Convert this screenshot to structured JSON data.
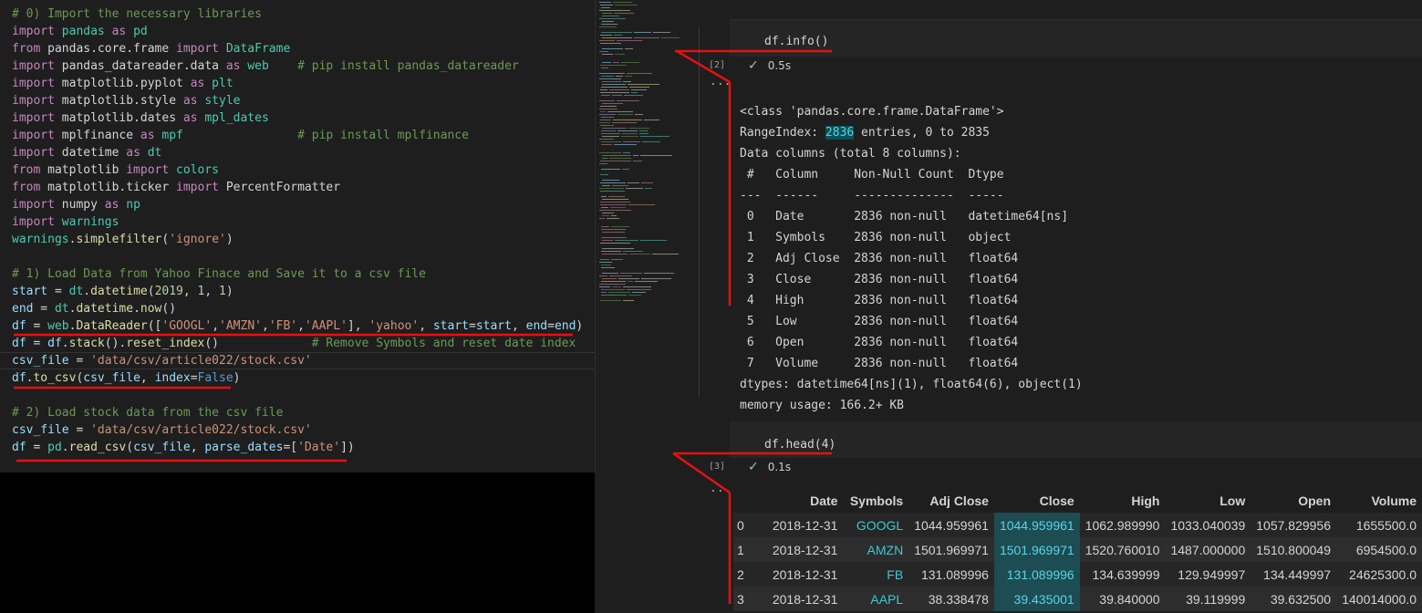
{
  "editor": {
    "lines": [
      [
        [
          "cm",
          "# 0) Import the necessary libraries"
        ]
      ],
      [
        [
          "kw",
          "import"
        ],
        [
          "plain",
          " "
        ],
        [
          "cls",
          "pandas"
        ],
        [
          "plain",
          " "
        ],
        [
          "kw",
          "as"
        ],
        [
          "plain",
          " "
        ],
        [
          "cls",
          "pd"
        ]
      ],
      [
        [
          "kw",
          "from"
        ],
        [
          "plain",
          " pandas.core.frame "
        ],
        [
          "kw",
          "import"
        ],
        [
          "plain",
          " "
        ],
        [
          "cls",
          "DataFrame"
        ]
      ],
      [
        [
          "kw",
          "import"
        ],
        [
          "plain",
          " pandas_datareader.data "
        ],
        [
          "kw",
          "as"
        ],
        [
          "plain",
          " "
        ],
        [
          "cls",
          "web"
        ],
        [
          "plain",
          "    "
        ],
        [
          "cm",
          "# pip install pandas_datareader"
        ]
      ],
      [
        [
          "kw",
          "import"
        ],
        [
          "plain",
          " matplotlib.pyplot "
        ],
        [
          "kw",
          "as"
        ],
        [
          "plain",
          " "
        ],
        [
          "cls",
          "plt"
        ]
      ],
      [
        [
          "kw",
          "import"
        ],
        [
          "plain",
          " matplotlib.style "
        ],
        [
          "kw",
          "as"
        ],
        [
          "plain",
          " "
        ],
        [
          "cls",
          "style"
        ]
      ],
      [
        [
          "kw",
          "import"
        ],
        [
          "plain",
          " matplotlib.dates "
        ],
        [
          "kw",
          "as"
        ],
        [
          "plain",
          " "
        ],
        [
          "cls",
          "mpl_dates"
        ]
      ],
      [
        [
          "kw",
          "import"
        ],
        [
          "plain",
          " mplfinance "
        ],
        [
          "kw",
          "as"
        ],
        [
          "plain",
          " "
        ],
        [
          "cls",
          "mpf"
        ],
        [
          "plain",
          "                "
        ],
        [
          "cm",
          "# pip install mplfinance"
        ]
      ],
      [
        [
          "kw",
          "import"
        ],
        [
          "plain",
          " datetime "
        ],
        [
          "kw",
          "as"
        ],
        [
          "plain",
          " "
        ],
        [
          "cls",
          "dt"
        ]
      ],
      [
        [
          "kw",
          "from"
        ],
        [
          "plain",
          " matplotlib "
        ],
        [
          "kw",
          "import"
        ],
        [
          "plain",
          " "
        ],
        [
          "cls",
          "colors"
        ]
      ],
      [
        [
          "kw",
          "from"
        ],
        [
          "plain",
          " matplotlib.ticker "
        ],
        [
          "kw",
          "import"
        ],
        [
          "plain",
          " PercentFormatter"
        ]
      ],
      [
        [
          "kw",
          "import"
        ],
        [
          "plain",
          " numpy "
        ],
        [
          "kw",
          "as"
        ],
        [
          "plain",
          " "
        ],
        [
          "cls",
          "np"
        ]
      ],
      [
        [
          "kw",
          "import"
        ],
        [
          "plain",
          " "
        ],
        [
          "cls",
          "warnings"
        ]
      ],
      [
        [
          "cls",
          "warnings"
        ],
        [
          "plain",
          "."
        ],
        [
          "fn",
          "simplefilter"
        ],
        [
          "plain",
          "("
        ],
        [
          "str",
          "'ignore'"
        ],
        [
          "plain",
          ")"
        ]
      ],
      [
        [
          "plain",
          ""
        ]
      ],
      [
        [
          "cm",
          "# 1) Load Data from Yahoo Finace and Save it to a csv file"
        ]
      ],
      [
        [
          "var",
          "start"
        ],
        [
          "plain",
          " = "
        ],
        [
          "cls",
          "dt"
        ],
        [
          "plain",
          "."
        ],
        [
          "fn",
          "datetime"
        ],
        [
          "plain",
          "("
        ],
        [
          "num",
          "2019"
        ],
        [
          "plain",
          ", "
        ],
        [
          "num",
          "1"
        ],
        [
          "plain",
          ", "
        ],
        [
          "num",
          "1"
        ],
        [
          "plain",
          ")"
        ]
      ],
      [
        [
          "var",
          "end"
        ],
        [
          "plain",
          " = "
        ],
        [
          "cls",
          "dt"
        ],
        [
          "plain",
          "."
        ],
        [
          "fn",
          "datetime"
        ],
        [
          "plain",
          "."
        ],
        [
          "fn",
          "now"
        ],
        [
          "plain",
          "()"
        ]
      ],
      [
        [
          "var",
          "df"
        ],
        [
          "plain",
          " = "
        ],
        [
          "cls",
          "web"
        ],
        [
          "plain",
          "."
        ],
        [
          "fn",
          "DataReader"
        ],
        [
          "plain",
          "(["
        ],
        [
          "str",
          "'GOOGL'"
        ],
        [
          "plain",
          ","
        ],
        [
          "str",
          "'AMZN'"
        ],
        [
          "plain",
          ","
        ],
        [
          "str",
          "'FB'"
        ],
        [
          "plain",
          ","
        ],
        [
          "str",
          "'AAPL'"
        ],
        [
          "plain",
          "], "
        ],
        [
          "str",
          "'yahoo'"
        ],
        [
          "plain",
          ", "
        ],
        [
          "var",
          "start"
        ],
        [
          "plain",
          "="
        ],
        [
          "var",
          "start"
        ],
        [
          "plain",
          ", "
        ],
        [
          "var",
          "end"
        ],
        [
          "plain",
          "="
        ],
        [
          "var",
          "end"
        ],
        [
          "plain",
          ")"
        ]
      ],
      [
        [
          "var",
          "df"
        ],
        [
          "plain",
          " = "
        ],
        [
          "var",
          "df"
        ],
        [
          "plain",
          "."
        ],
        [
          "fn",
          "stack"
        ],
        [
          "plain",
          "()."
        ],
        [
          "fn",
          "reset_index"
        ],
        [
          "plain",
          "()"
        ],
        [
          "plain",
          "             "
        ],
        [
          "cm",
          "# Remove Symbols and reset date index"
        ]
      ],
      [
        [
          "var",
          "csv_file"
        ],
        [
          "plain",
          " = "
        ],
        [
          "str",
          "'data/csv/article022/stock.csv'"
        ]
      ],
      [
        [
          "var",
          "df"
        ],
        [
          "plain",
          "."
        ],
        [
          "fn",
          "to_csv"
        ],
        [
          "plain",
          "("
        ],
        [
          "var",
          "csv_file"
        ],
        [
          "plain",
          ", "
        ],
        [
          "var",
          "index"
        ],
        [
          "plain",
          "="
        ],
        [
          "cst",
          "False"
        ],
        [
          "plain",
          ")"
        ]
      ],
      [
        [
          "plain",
          ""
        ]
      ],
      [
        [
          "cm",
          "# 2) Load stock data from the csv file"
        ]
      ],
      [
        [
          "var",
          "csv_file"
        ],
        [
          "plain",
          " = "
        ],
        [
          "str",
          "'data/csv/article022/stock.csv'"
        ]
      ],
      [
        [
          "var",
          "df"
        ],
        [
          "plain",
          " = "
        ],
        [
          "cls",
          "pd"
        ],
        [
          "plain",
          "."
        ],
        [
          "fn",
          "read_csv"
        ],
        [
          "plain",
          "("
        ],
        [
          "var",
          "csv_file"
        ],
        [
          "plain",
          ", "
        ],
        [
          "var",
          "parse_dates"
        ],
        [
          "plain",
          "=["
        ],
        [
          "str",
          "'Date'"
        ],
        [
          "plain",
          "])"
        ]
      ]
    ]
  },
  "cells": {
    "info": {
      "code": "df.info()",
      "counter": "[2]",
      "time": "0.5s"
    },
    "head": {
      "code": "df.head(4)",
      "counter": "[3]",
      "time": "0.1s"
    }
  },
  "info_output": {
    "class_line": "<class 'pandas.core.frame.DataFrame'>",
    "range_prefix": "RangeIndex: ",
    "range_count": "2836",
    "range_suffix": " entries, 0 to 2835",
    "data_columns": "Data columns (total 8 columns):",
    "header": " #   Column     Non-Null Count  Dtype",
    "dashes": "---  ------     --------------  -----",
    "rows": [
      " 0   Date       2836 non-null   datetime64[ns]",
      " 1   Symbols    2836 non-null   object",
      " 2   Adj Close  2836 non-null   float64",
      " 3   Close      2836 non-null   float64",
      " 4   High       2836 non-null   float64",
      " 5   Low        2836 non-null   float64",
      " 6   Open       2836 non-null   float64",
      " 7   Volume     2836 non-null   float64"
    ],
    "dtypes": "dtypes: datetime64[ns](1), float64(6), object(1)",
    "memory": "memory usage: 166.2+ KB"
  },
  "head_table": {
    "columns": [
      "",
      "Date",
      "Symbols",
      "Adj Close",
      "Close",
      "High",
      "Low",
      "Open",
      "Volume"
    ],
    "rows": [
      [
        "0",
        "2018-12-31",
        "GOOGL",
        "1044.959961",
        "1044.959961",
        "1062.989990",
        "1033.040039",
        "1057.829956",
        "1655500.0"
      ],
      [
        "1",
        "2018-12-31",
        "AMZN",
        "1501.969971",
        "1501.969971",
        "1520.760010",
        "1487.000000",
        "1510.800049",
        "6954500.0"
      ],
      [
        "2",
        "2018-12-31",
        "FB",
        "131.089996",
        "131.089996",
        "134.639999",
        "129.949997",
        "134.449997",
        "24625300.0"
      ],
      [
        "3",
        "2018-12-31",
        "AAPL",
        "38.338478",
        "39.435001",
        "39.840000",
        "39.119999",
        "39.632500",
        "140014000.0"
      ]
    ]
  },
  "icons": {
    "check": "check-icon",
    "more": "more-icon"
  },
  "colors": {
    "annotation": "#e81010",
    "highlight": "#56d6e6"
  }
}
